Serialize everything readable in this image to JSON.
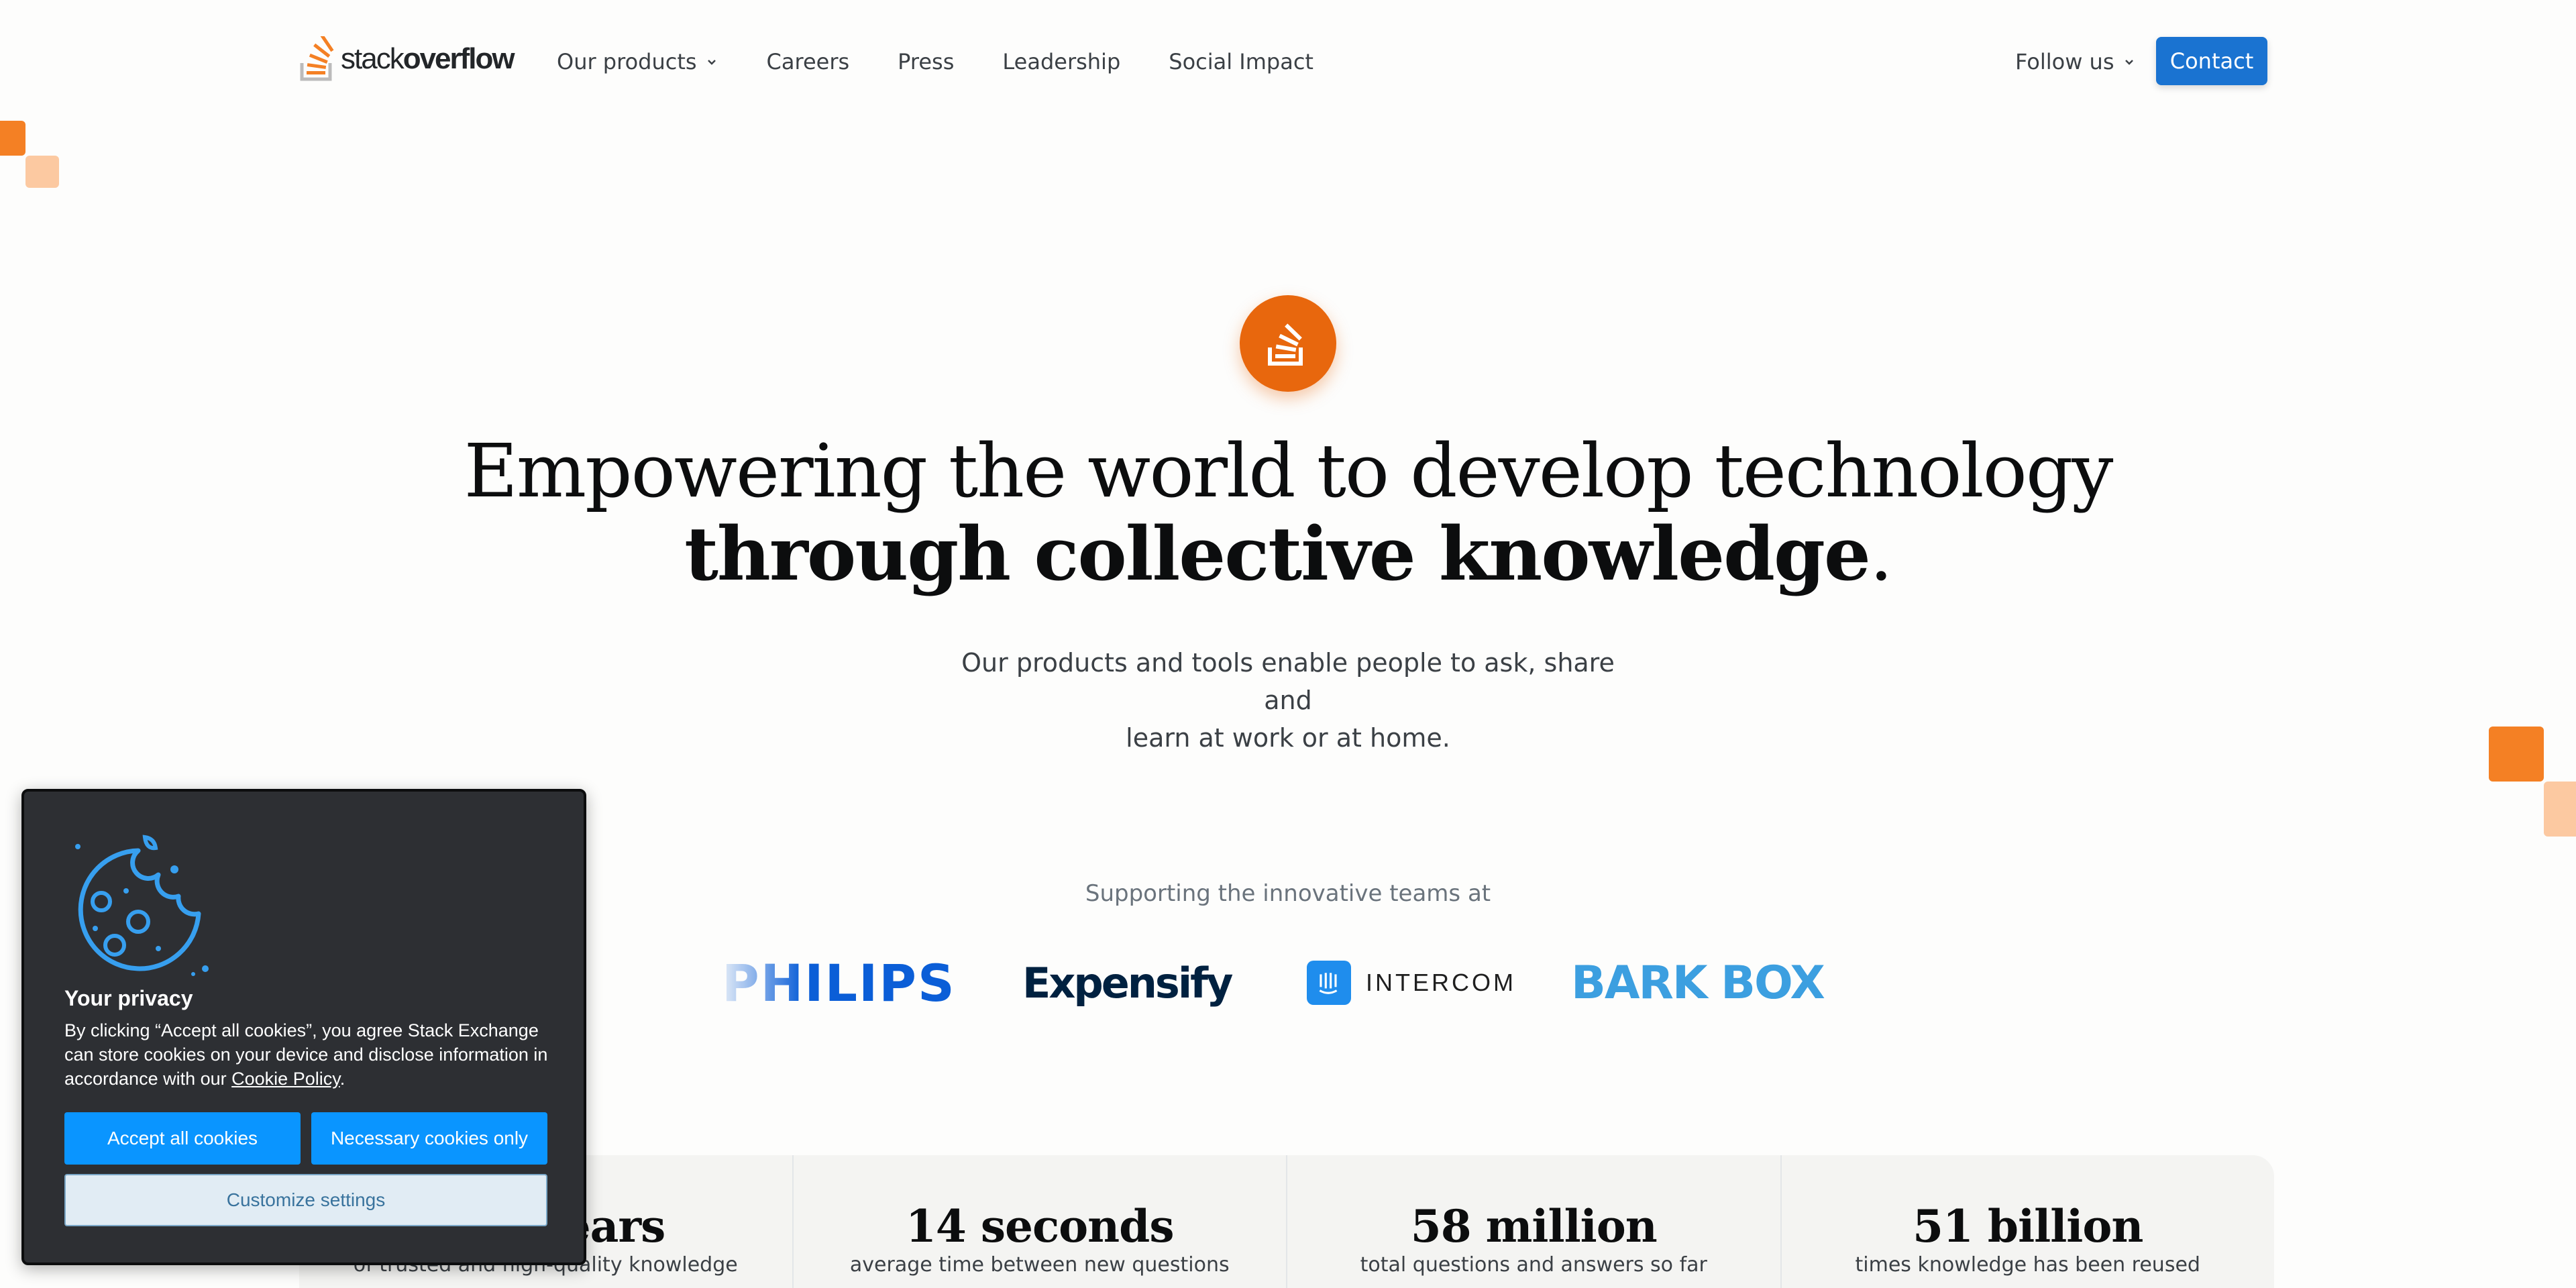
{
  "brand": {
    "logo_light": "stack",
    "logo_bold": "overflow",
    "accent": "#f48024",
    "primary_button": "#1a73d1"
  },
  "nav": {
    "items": [
      {
        "label": "Our products",
        "has_dropdown": true
      },
      {
        "label": "Careers"
      },
      {
        "label": "Press"
      },
      {
        "label": "Leadership"
      },
      {
        "label": "Social Impact"
      }
    ],
    "follow_label": "Follow us",
    "contact_label": "Contact"
  },
  "hero": {
    "title_line1": "Empowering the world to develop technology",
    "title_line2_bold": "through collective knowledge",
    "title_line2_end": ".",
    "subtitle_line1": "Our products and tools enable people to ask, share and",
    "subtitle_line2": "learn at work or at home."
  },
  "partners": {
    "heading": "Supporting the innovative teams at",
    "logos": [
      "PHILIPS",
      "Expensify",
      "INTERCOM",
      "BARK BOX"
    ]
  },
  "stats": [
    {
      "value": "15+ years",
      "label": "of trusted and high-quality knowledge"
    },
    {
      "value": "14 seconds",
      "label": "average time between new questions"
    },
    {
      "value": "58 million",
      "label": "total questions and answers so far"
    },
    {
      "value": "51 billion",
      "label": "times knowledge has been reused"
    }
  ],
  "cookie": {
    "title": "Your privacy",
    "text_before": "By clicking “Accept all cookies”, you agree Stack Exchange can store cookies on your device and disclose information in accordance with our ",
    "link": "Cookie Policy",
    "text_after": ".",
    "accept_label": "Accept all cookies",
    "necessary_label": "Necessary cookies only",
    "customize_label": "Customize settings"
  }
}
